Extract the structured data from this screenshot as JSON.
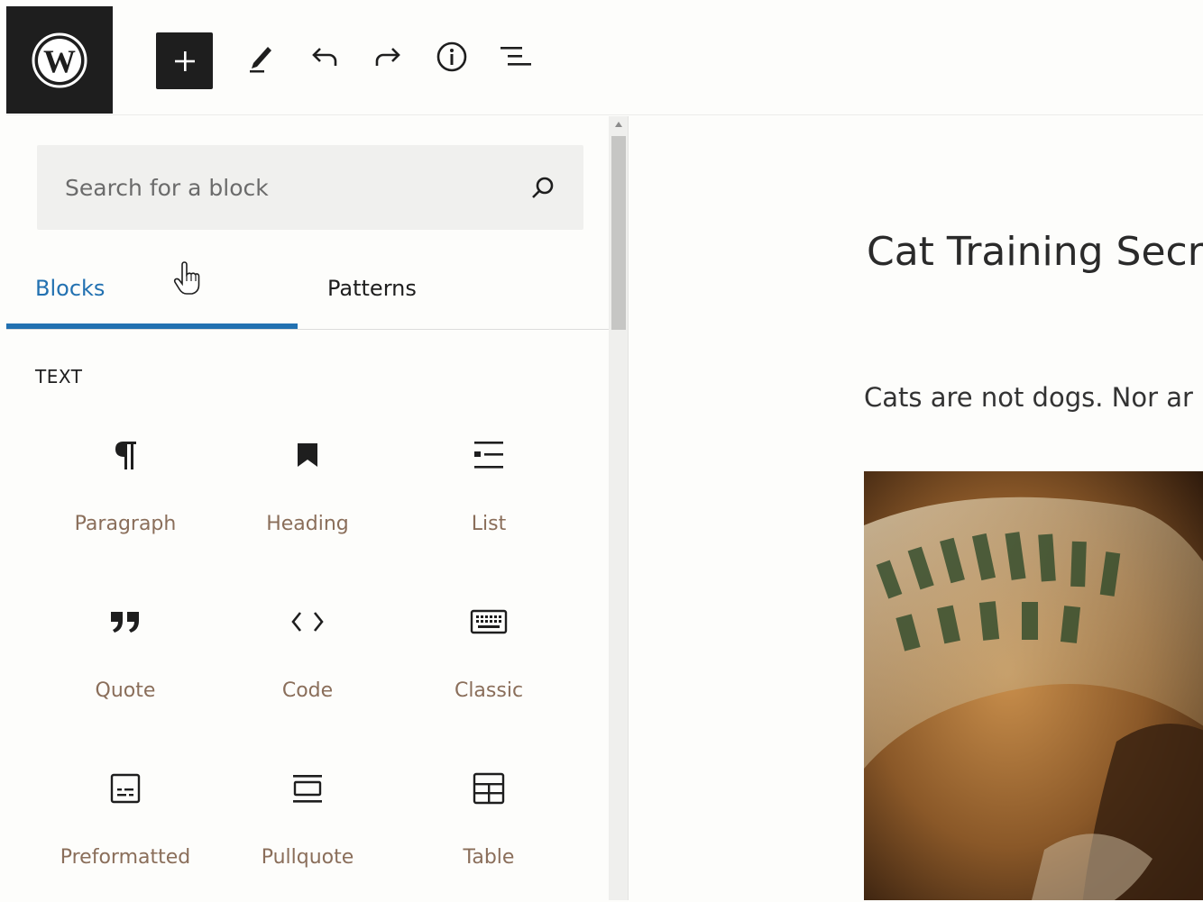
{
  "toolbar": {
    "logo": "wordpress-logo",
    "tools": [
      "add-block",
      "edit-tools",
      "undo",
      "redo",
      "details",
      "outline"
    ]
  },
  "sidebar": {
    "search_placeholder": "Search for a block",
    "tabs": [
      {
        "label": "Blocks",
        "active": true
      },
      {
        "label": "Patterns",
        "active": false
      }
    ],
    "category": "TEXT",
    "blocks": [
      {
        "label": "Paragraph",
        "icon": "paragraph-icon"
      },
      {
        "label": "Heading",
        "icon": "bookmark-icon"
      },
      {
        "label": "List",
        "icon": "list-icon"
      },
      {
        "label": "Quote",
        "icon": "quote-icon"
      },
      {
        "label": "Code",
        "icon": "code-icon"
      },
      {
        "label": "Classic",
        "icon": "keyboard-icon"
      },
      {
        "label": "Preformatted",
        "icon": "preformatted-icon"
      },
      {
        "label": "Pullquote",
        "icon": "pullquote-icon"
      },
      {
        "label": "Table",
        "icon": "table-icon"
      }
    ]
  },
  "editor": {
    "title": "Cat Training Secre",
    "paragraph": "Cats are not dogs. Nor ar"
  },
  "colors": {
    "accent": "#2271b1",
    "dark": "#1e1e1e",
    "label": "#8a6e5a"
  }
}
